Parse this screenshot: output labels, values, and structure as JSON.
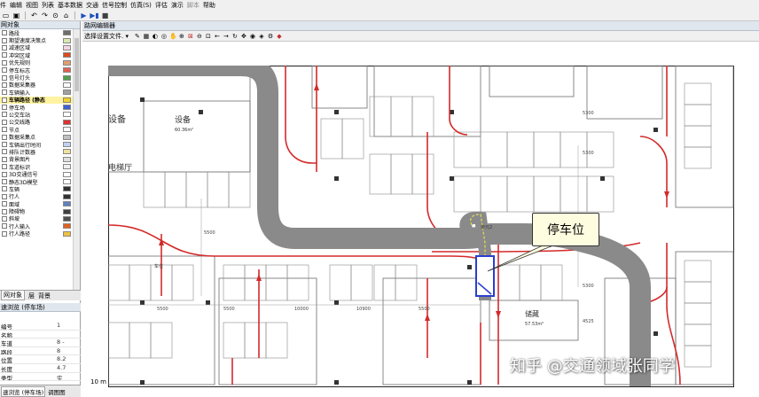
{
  "menu": [
    "件",
    "编辑",
    "视图",
    "列表",
    "基本数据",
    "交通",
    "信号控制",
    "仿真(S)",
    "评估",
    "演示",
    "脚本",
    "帮助"
  ],
  "toolbar_icons": [
    "open-icon",
    "save-icon",
    "undo-icon",
    "redo-icon",
    "zoom-icon",
    "home-icon",
    "play-icon",
    "step-icon",
    "stop-icon"
  ],
  "left_panel": {
    "title": "网对象",
    "items": [
      {
        "label": "路段",
        "color": "#6e6e6e"
      },
      {
        "label": "期望速度决策点",
        "color": "#d8e8b0"
      },
      {
        "label": "减速区域",
        "color": "#f3d4e0"
      },
      {
        "label": "冲突区域",
        "color": "#d94b1f"
      },
      {
        "label": "优先规则",
        "color": "#e0a070"
      },
      {
        "label": "停车标志",
        "color": "#e06050"
      },
      {
        "label": "信号灯头",
        "color": "#50a050"
      },
      {
        "label": "数据采集器",
        "color": "#ffffff"
      },
      {
        "label": "车辆输入",
        "color": "#a0a0a0"
      },
      {
        "label": "车辆路径 (静态",
        "color": "#f2d030",
        "selected": true
      },
      {
        "label": "停车场",
        "color": "#4060d0"
      },
      {
        "label": "公交车站",
        "color": "#ffffff"
      },
      {
        "label": "公交线路",
        "color": "#e03030"
      },
      {
        "label": "节点",
        "color": "#ffffff"
      },
      {
        "label": "数据采集点",
        "color": "#c0c0c0"
      },
      {
        "label": "车辆出行时间",
        "color": "#c0d0f0"
      },
      {
        "label": "排队计数器",
        "color": "#f0e0a0"
      },
      {
        "label": "背景图片",
        "color": "#e0e0e0"
      },
      {
        "label": "车道标识",
        "color": "#f0f0f0"
      },
      {
        "label": "3D交通信号",
        "color": "#ffffff"
      },
      {
        "label": "静态3D模型",
        "color": "#ffffff"
      },
      {
        "label": "车辆",
        "color": "#303030"
      },
      {
        "label": "行人",
        "color": "#303030"
      },
      {
        "label": "面域",
        "color": "#6080c0"
      },
      {
        "label": "障碍物",
        "color": "#404040"
      },
      {
        "label": "斜坡",
        "color": "#505050"
      },
      {
        "label": "行人输入",
        "color": "#e06020"
      },
      {
        "label": "行人路径",
        "color": "#f0c040"
      }
    ]
  },
  "panel_tabs": [
    "网对象",
    "层",
    "背景"
  ],
  "props_panel": {
    "title": "速浏览 (停车场)",
    "rows": [
      {
        "key": "编号",
        "value": "1"
      },
      {
        "key": "名称",
        "value": ""
      },
      {
        "key": "车道",
        "value": "8 -"
      },
      {
        "key": "路段",
        "value": "8"
      },
      {
        "key": "位置",
        "value": "8.2"
      },
      {
        "key": "长度",
        "value": "4.7"
      },
      {
        "key": "类型",
        "value": "实"
      }
    ]
  },
  "bottom_tabs": [
    "速浏览 (停车场)",
    "调图图"
  ],
  "editor": {
    "title": "路网编辑器",
    "select_mode": "选择设置文件."
  },
  "map": {
    "room_labels": [
      "设备",
      "设备",
      "电梯厅",
      "储藏",
      "车位",
      "车位",
      "单元2"
    ],
    "room_areas": [
      "60.36m²",
      "57.53m²"
    ],
    "dimension_labels": [
      "5500",
      "5500",
      "10000",
      "5500",
      "10900",
      "5300",
      "5300",
      "5300",
      "4525",
      "5500"
    ],
    "scale": "10 m"
  },
  "callout": "停车位",
  "watermark": "知乎 @交通领域张同学",
  "colors": {
    "road": "#8a8a8a",
    "route": "#d42a2a",
    "parking": "#2a3fd0",
    "route_selected": "#e6e04a"
  }
}
